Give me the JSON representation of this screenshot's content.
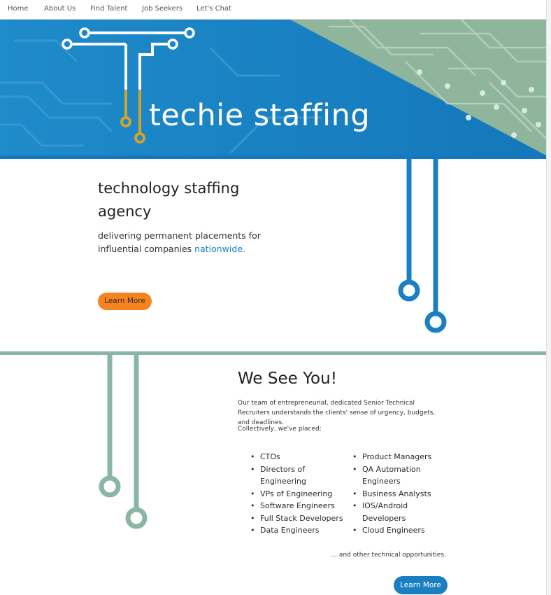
{
  "nav": {
    "items": [
      "Home",
      "About Us",
      "Find Talent",
      "Job Seekers",
      "Let's Chat"
    ]
  },
  "hero": {
    "brand": "techie staffing"
  },
  "intro": {
    "title": "technology staffing agency",
    "description": "delivering permanent placements for influential companies",
    "link_text": "nationwide.",
    "button": "Learn More"
  },
  "about": {
    "title": "We See You!",
    "paragraph": "Our team of entrepreneurial, dedicated Senior Technical Recruiters understands the clients' sense of urgency, budgets, and deadlines.",
    "lead": "Collectively, we've placed:",
    "col1": [
      "CTOs",
      "Directors of Engineering",
      "VPs of Engineering",
      "Software Engineers",
      "Full Stack Developers",
      "Data Engineers"
    ],
    "col2": [
      "Product Managers",
      "QA Automation Engineers",
      "Business Analysts",
      "IOS/Android Developers",
      "Cloud Engineers"
    ],
    "more": "... and other technical opportunities.",
    "button": "Learn More"
  },
  "colors": {
    "primary_blue": "#1b87c6",
    "accent_orange": "#f58320",
    "sage_green": "#8ab6a4",
    "gold": "#d4a32b"
  }
}
